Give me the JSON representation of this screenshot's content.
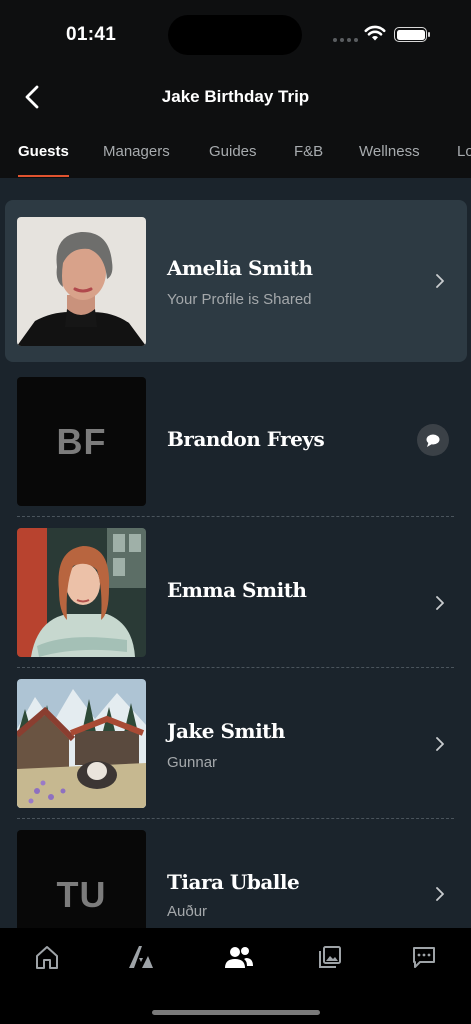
{
  "status_bar": {
    "time": "01:41"
  },
  "header": {
    "title": "Jake Birthday Trip"
  },
  "tabs": [
    {
      "label": "Guests",
      "active": true
    },
    {
      "label": "Managers",
      "active": false
    },
    {
      "label": "Guides",
      "active": false
    },
    {
      "label": "F&B",
      "active": false
    },
    {
      "label": "Wellness",
      "active": false
    },
    {
      "label": "Lo",
      "active": false
    }
  ],
  "guests": [
    {
      "name": "Amelia Smith",
      "subtitle": "Your Profile is Shared",
      "initials": "",
      "action": "chevron-right-icon",
      "highlighted": true
    },
    {
      "name": "Brandon Freys",
      "subtitle": "",
      "initials": "BF",
      "action": "chat-bubble-icon",
      "highlighted": false
    },
    {
      "name": "Emma Smith",
      "subtitle": "",
      "initials": "",
      "action": "chevron-right-icon",
      "highlighted": false
    },
    {
      "name": "Jake Smith",
      "subtitle": "Gunnar",
      "initials": "",
      "action": "chevron-right-icon",
      "highlighted": false
    },
    {
      "name": "Tiara Uballe",
      "subtitle": "Auður",
      "initials": "TU",
      "action": "chevron-right-icon",
      "highlighted": false
    }
  ],
  "bottom_nav": [
    {
      "icon": "home-icon",
      "active": false
    },
    {
      "icon": "itinerary-icon",
      "active": false
    },
    {
      "icon": "people-icon",
      "active": true
    },
    {
      "icon": "gallery-icon",
      "active": false
    },
    {
      "icon": "chat-icon",
      "active": false
    }
  ],
  "colors": {
    "accent": "#e0532f",
    "content_bg": "#1b242c",
    "highlight_card": "#2d3a43",
    "header_bg": "#0e0f10"
  }
}
